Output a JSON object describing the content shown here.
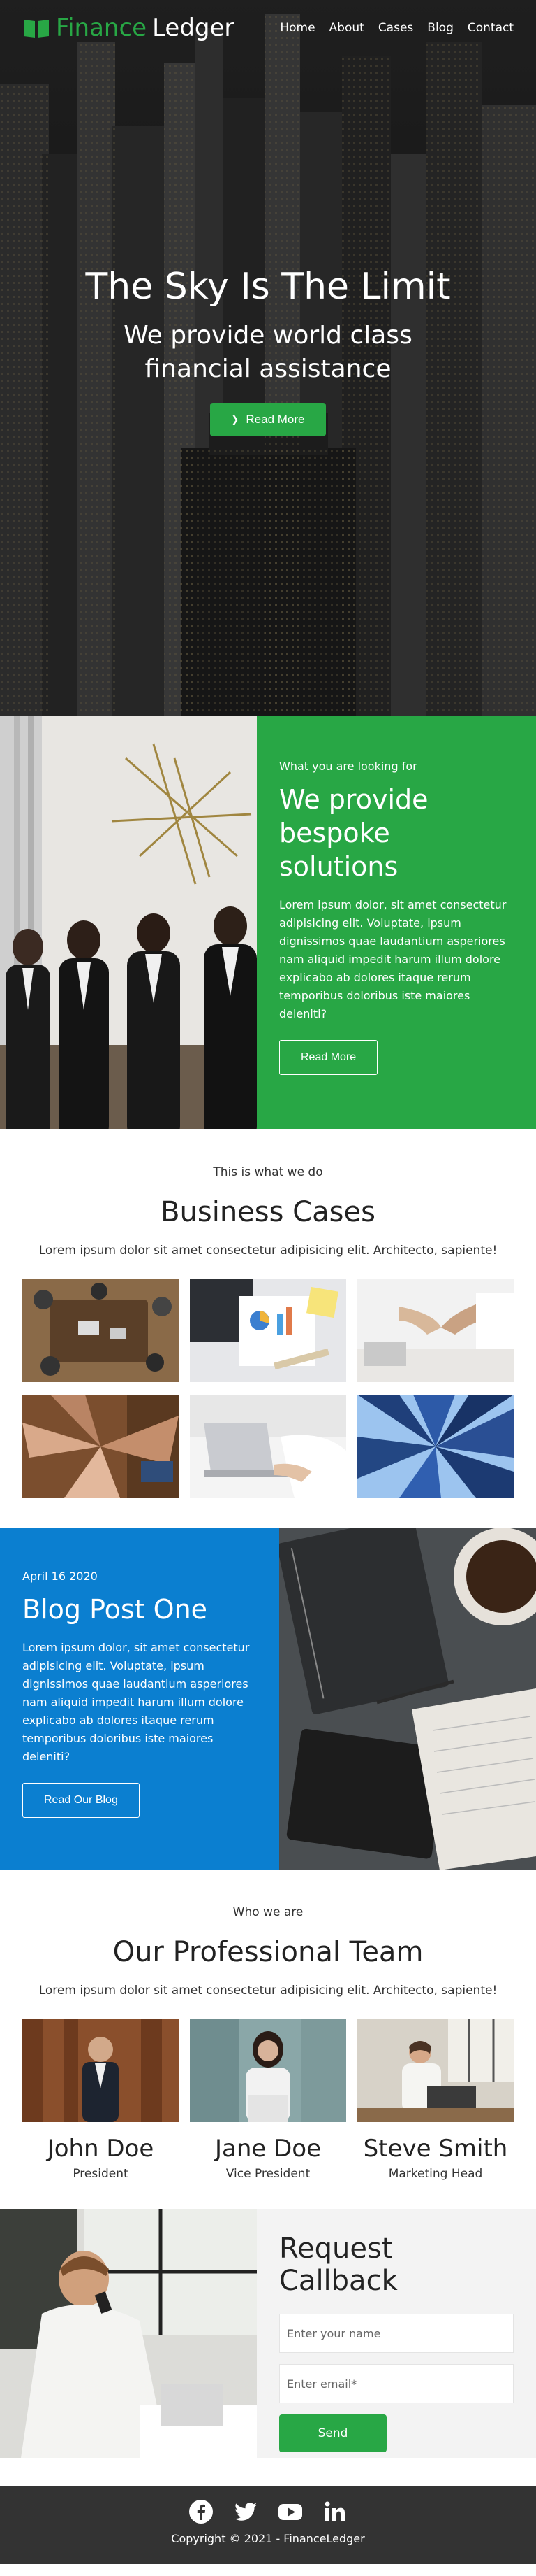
{
  "nav": {
    "brand_part1": "Finance",
    "brand_part2": "Ledger",
    "links": [
      "Home",
      "About",
      "Cases",
      "Blog",
      "Contact"
    ]
  },
  "hero": {
    "title": "The Sky Is The Limit",
    "subtitle_line1": "We provide world class",
    "subtitle_line2": "financial assistance",
    "button": "Read More"
  },
  "bespoke": {
    "eyebrow": "What you are looking for",
    "heading": "We provide bespoke solutions",
    "paragraph": "Lorem ipsum dolor, sit amet consectetur adipisicing elit. Voluptate, ipsum dignissimos quae laudantium asperiores nam aliquid impedit harum illum dolore explicabo ab dolores itaque rerum temporibus doloribus iste maiores deleniti?",
    "button": "Read More"
  },
  "cases": {
    "eyebrow": "This is what we do",
    "title": "Business Cases",
    "description": "Lorem ipsum dolor sit amet consectetur adipisicing elit. Architecto, sapiente!"
  },
  "blog": {
    "date": "April 16 2020",
    "title": "Blog Post One",
    "paragraph": "Lorem ipsum dolor, sit amet consectetur adipisicing elit. Voluptate, ipsum dignissimos quae laudantium asperiores nam aliquid impedit harum illum dolore explicabo ab dolores itaque rerum temporibus doloribus iste maiores deleniti?",
    "button": "Read Our Blog"
  },
  "team": {
    "eyebrow": "Who we are",
    "title": "Our Professional Team",
    "description": "Lorem ipsum dolor sit amet consectetur adipisicing elit. Architecto, sapiente!",
    "members": [
      {
        "name": "John Doe",
        "role": "President"
      },
      {
        "name": "Jane Doe",
        "role": "Vice President"
      },
      {
        "name": "Steve Smith",
        "role": "Marketing Head"
      }
    ]
  },
  "callback": {
    "title": "Request Callback",
    "name_placeholder": "Enter your name",
    "email_placeholder": "Enter email*",
    "button": "Send"
  },
  "footer": {
    "social_icons": [
      "facebook-icon",
      "twitter-icon",
      "youtube-icon",
      "linkedin-icon"
    ],
    "copyright": "Copyright © 2021 - FinanceLedger"
  },
  "colors": {
    "green": "#28a745",
    "blue": "#0b7fd0",
    "footer": "#333333"
  }
}
